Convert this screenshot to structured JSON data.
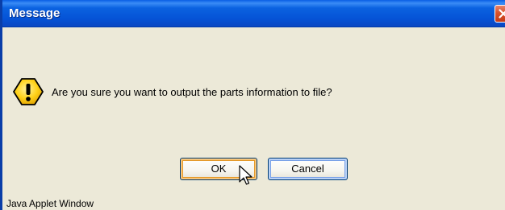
{
  "window": {
    "title": "Message",
    "accent_color": "#0553d6",
    "close_color": "#d8532d"
  },
  "dialog": {
    "icon": "warning-icon",
    "message": "Are you sure you want to output the parts information to file?",
    "buttons": {
      "ok_label": "OK",
      "cancel_label": "Cancel"
    }
  },
  "footer": {
    "text": "Java Applet Window"
  },
  "cursor": "mouse-pointer-icon"
}
